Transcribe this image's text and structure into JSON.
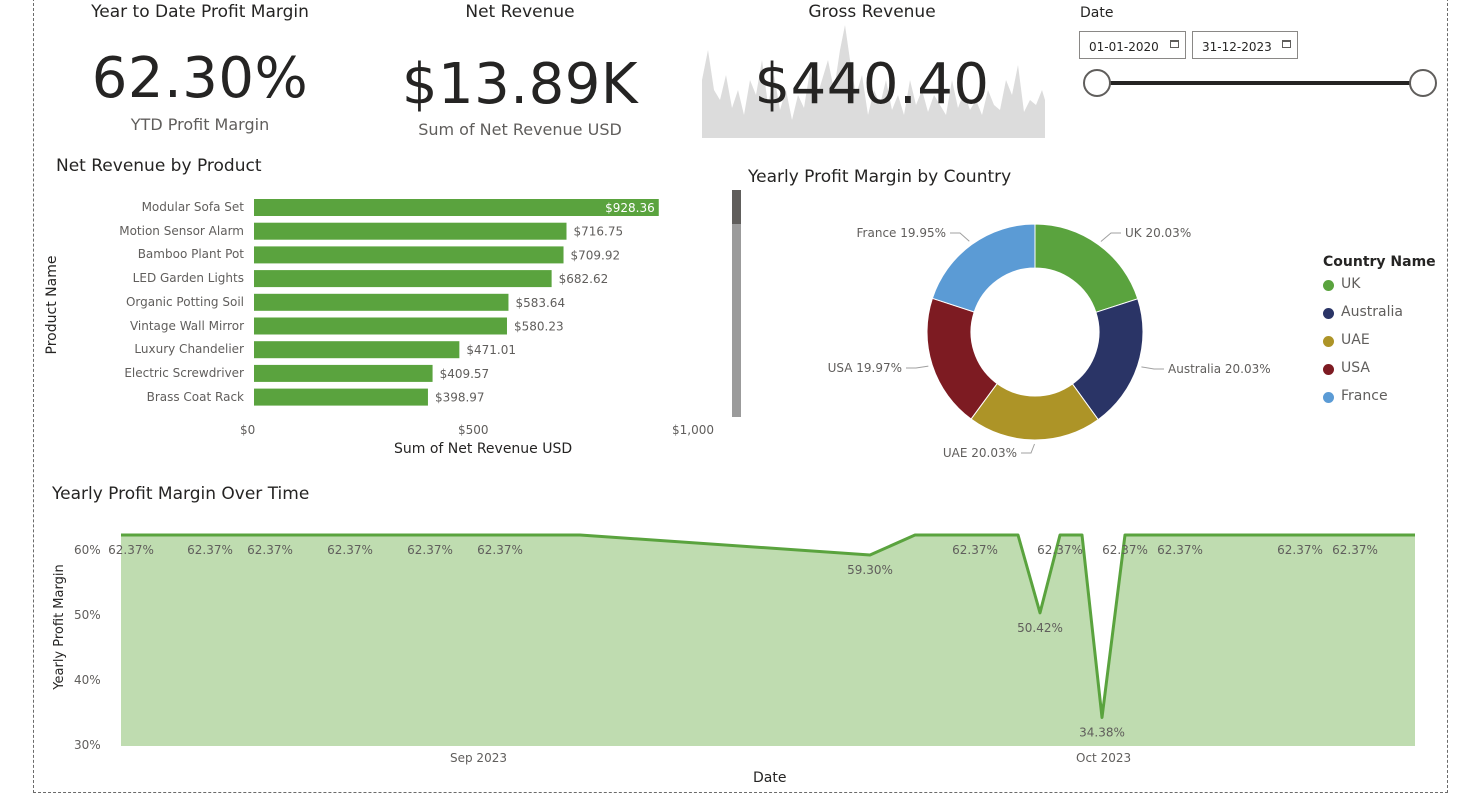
{
  "kpis": {
    "ytd": {
      "title": "Year to Date Profit Margin",
      "value": "62.30%",
      "subtitle": "YTD Profit Margin"
    },
    "net": {
      "title": "Net Revenue",
      "value": "$13.89K",
      "subtitle": "Sum of Net Revenue USD"
    },
    "gross": {
      "title": "Gross Revenue",
      "value": "$440.40"
    }
  },
  "date_filter": {
    "label": "Date",
    "start": "01-01-2020",
    "end": "31-12-2023",
    "range": [
      0,
      1
    ]
  },
  "bar_chart": {
    "title": "Net Revenue by Product",
    "ylabel": "Product Name",
    "xlabel": "Sum of Net Revenue USD",
    "ticks": [
      "$0",
      "$500",
      "$1,000"
    ],
    "bar_color": "#5aa33e"
  },
  "donut_chart": {
    "title": "Yearly Profit Margin by Country",
    "legend_title": "Country Name"
  },
  "line_chart": {
    "title": "Yearly Profit Margin Over Time",
    "ylabel": "Yearly Profit Margin",
    "xlabel": "Date",
    "yticks": [
      "60%",
      "50%",
      "40%",
      "30%"
    ],
    "xticks": [
      "Sep 2023",
      "Oct 2023"
    ]
  },
  "chart_data": [
    {
      "type": "bar",
      "title": "Net Revenue by Product",
      "xlabel": "Sum of Net Revenue USD",
      "ylabel": "Product Name",
      "xlim": [
        0,
        1000
      ],
      "categories": [
        "Modular Sofa Set",
        "Motion Sensor Alarm",
        "Bamboo Plant Pot",
        "LED Garden Lights",
        "Organic Potting Soil",
        "Vintage Wall Mirror",
        "Luxury Chandelier",
        "Electric Screwdriver",
        "Brass Coat Rack"
      ],
      "values": [
        928.36,
        716.75,
        709.92,
        682.62,
        583.64,
        580.23,
        471.01,
        409.57,
        398.97
      ],
      "labels": [
        "$928.36",
        "$716.75",
        "$709.92",
        "$682.62",
        "$583.64",
        "$580.23",
        "$471.01",
        "$409.57",
        "$398.97"
      ]
    },
    {
      "type": "pie",
      "title": "Yearly Profit Margin by Country",
      "legend_title": "Country Name",
      "legend_position": "right",
      "slices": [
        {
          "name": "UK",
          "value": 20.03,
          "label": "UK 20.03%",
          "color": "#5aa33e"
        },
        {
          "name": "Australia",
          "value": 20.03,
          "label": "Australia 20.03%",
          "color": "#2a3466"
        },
        {
          "name": "UAE",
          "value": 20.03,
          "label": "UAE 20.03%",
          "color": "#ad9427"
        },
        {
          "name": "USA",
          "value": 19.97,
          "label": "USA 19.97%",
          "color": "#7d1b22"
        },
        {
          "name": "France",
          "value": 19.95,
          "label": "France 19.95%",
          "color": "#5b9bd5"
        }
      ]
    },
    {
      "type": "area",
      "title": "Yearly Profit Margin Over Time",
      "xlabel": "Date",
      "ylabel": "Yearly Profit Margin",
      "ylim": [
        30,
        62.37
      ],
      "x_tick_labels": [
        "Sep 2023",
        "Oct 2023"
      ],
      "color": "#5aa33e",
      "fill": "#bfdcb0",
      "values": [
        62.37,
        62.37,
        62.37,
        62.37,
        62.37,
        62.37,
        62.37,
        59.3,
        62.37,
        62.37,
        62.37,
        50.42,
        62.37,
        62.37,
        34.38,
        62.37,
        62.37,
        62.37,
        62.37,
        62.37,
        62.37
      ],
      "data_labels": [
        "62.37%",
        "62.37%",
        "62.37%",
        "62.37%",
        "62.37%",
        "62.37%",
        "",
        "59.30%",
        "",
        "62.37%",
        "",
        "50.42%",
        "62.37%",
        "",
        "34.38%",
        "62.37%",
        "62.37%",
        "",
        "62.37%",
        "62.37%",
        ""
      ]
    }
  ]
}
